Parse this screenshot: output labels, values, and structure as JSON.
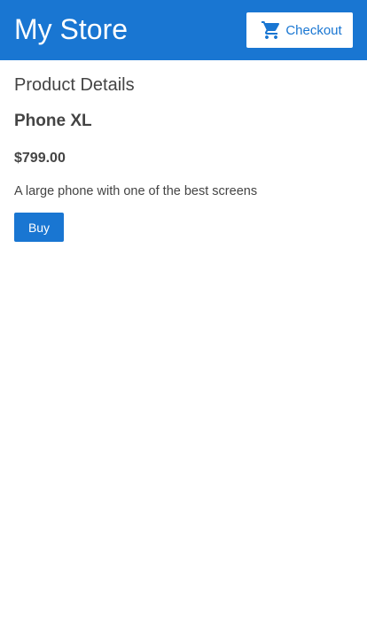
{
  "header": {
    "title": "My Store",
    "checkout": {
      "label": "Checkout",
      "icon": "shopping-cart-icon"
    }
  },
  "main": {
    "heading": "Product Details",
    "product": {
      "name": "Phone XL",
      "price": "$799.00",
      "description": "A large phone with one of the best screens"
    },
    "buy_label": "Buy"
  },
  "colors": {
    "primary": "#1976d2",
    "text": "#444444",
    "background": "#ffffff"
  }
}
